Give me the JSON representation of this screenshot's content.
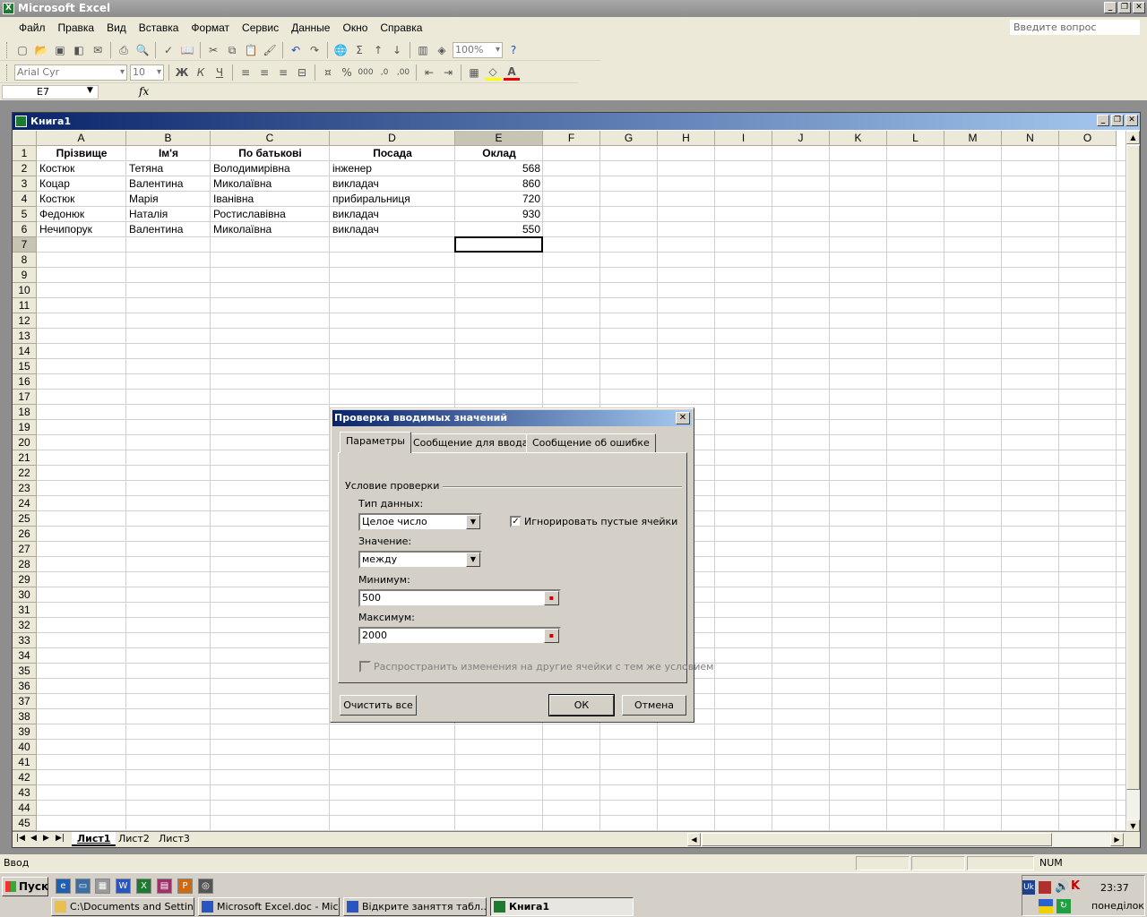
{
  "app": {
    "title": "Microsoft Excel",
    "ask_placeholder": "Введите вопрос"
  },
  "menu": [
    "Файл",
    "Правка",
    "Вид",
    "Вставка",
    "Формат",
    "Сервис",
    "Данные",
    "Окно",
    "Справка"
  ],
  "toolbar": {
    "zoom": "100%",
    "font": "Arial Cyr",
    "size": "10",
    "bold": "Ж",
    "italic": "К",
    "underline": "Ч"
  },
  "formula_bar": {
    "name_box": "E7",
    "fx": "fx"
  },
  "workbook": {
    "title": "Книга1"
  },
  "columns": [
    "A",
    "B",
    "C",
    "D",
    "E",
    "F",
    "G",
    "H",
    "I",
    "J",
    "K",
    "L",
    "M",
    "N",
    "O"
  ],
  "rows": [
    "1",
    "2",
    "3",
    "4",
    "5",
    "6",
    "7",
    "8",
    "9",
    "10",
    "11",
    "12",
    "13",
    "14",
    "15",
    "16",
    "17",
    "18",
    "19",
    "20",
    "21",
    "22",
    "23",
    "24",
    "25",
    "26",
    "27",
    "28",
    "29",
    "30",
    "31",
    "32",
    "33",
    "34",
    "35",
    "36",
    "37",
    "38",
    "39",
    "40",
    "41",
    "42",
    "43",
    "44",
    "45"
  ],
  "table": {
    "headers": [
      "Прізвище",
      "Ім'я",
      "По батькові",
      "Посада",
      "Оклад"
    ],
    "rows": [
      [
        "Костюк",
        "Тетяна",
        "Володимирівна",
        "інженер",
        "568"
      ],
      [
        "Коцар",
        "Валентина",
        "Миколаївна",
        "викладач",
        "860"
      ],
      [
        "Костюк",
        "Марія",
        "Іванівна",
        "прибиральниця",
        "720"
      ],
      [
        "Федонюк",
        "Наталія",
        "Ростиславівна",
        "викладач",
        "930"
      ],
      [
        "Нечипорук",
        "Валентина",
        "Миколаївна",
        "викладач",
        "550"
      ]
    ]
  },
  "sheets": [
    "Лист1",
    "Лист2",
    "Лист3"
  ],
  "status": {
    "mode": "Ввод",
    "num": "NUM"
  },
  "dialog": {
    "title": "Проверка вводимых значений",
    "tabs": [
      "Параметры",
      "Сообщение для ввода",
      "Сообщение об ошибке"
    ],
    "group": "Условие проверки",
    "type_label": "Тип данных:",
    "type_value": "Целое число",
    "ignore_blank": "Игнорировать пустые ячейки",
    "value_label": "Значение:",
    "value_value": "между",
    "min_label": "Минимум:",
    "min_value": "500",
    "max_label": "Максимум:",
    "max_value": "2000",
    "propagate": "Распространить изменения на другие ячейки с тем же условием",
    "clear_all": "Очистить все",
    "ok": "ОК",
    "cancel": "Отмена"
  },
  "taskbar": {
    "start": "Пуск",
    "tasks": [
      "C:\\Documents and Settin...",
      "Microsoft Excel.doc - Mic...",
      "Відкрите заняття табл....",
      "Книга1"
    ],
    "lang": "Uk",
    "time": "23:37",
    "day": "понеділок"
  }
}
